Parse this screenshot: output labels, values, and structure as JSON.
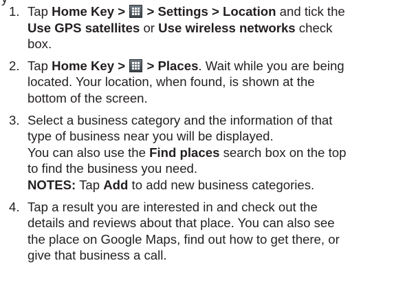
{
  "top_fragment": "y",
  "steps": [
    {
      "number": "1.",
      "line1": {
        "prefix": "Tap ",
        "home_key": "Home Key >",
        "settings": " > Settings > Location",
        "suffix": " and tick the"
      },
      "line2": {
        "use_gps": "Use GPS satellites",
        "or": " or ",
        "use_wireless": "Use wireless networks",
        "suffix": " check"
      },
      "line3": "box."
    },
    {
      "number": "2.",
      "line1": {
        "prefix": "Tap ",
        "home_key": "Home Key >",
        "places": " > Places",
        "suffix": ". Wait while you are being"
      },
      "line2": "located. Your location, when found, is shown at the",
      "line3": "bottom of the screen."
    },
    {
      "number": "3.",
      "line1": "Select a business category and the information of that",
      "line2": "type of business near you will be displayed.",
      "line3": {
        "prefix": "You can also use the ",
        "find_places": "Find places",
        "suffix": " search box on the top"
      },
      "line4": "to find the business you need.",
      "line5": {
        "notes": "NOTES:",
        "mid": " Tap ",
        "add": "Add",
        "suffix": " to add new business categories."
      }
    },
    {
      "number": "4.",
      "line1": "Tap a result you are interested in and check out the",
      "line2": "details and reviews about that place. You can also see",
      "line3": "the place on Google Maps, find out how to get there, or",
      "line4": "give that business a call."
    }
  ],
  "icons": {
    "apps_grid": "app-drawer-grid-icon"
  }
}
